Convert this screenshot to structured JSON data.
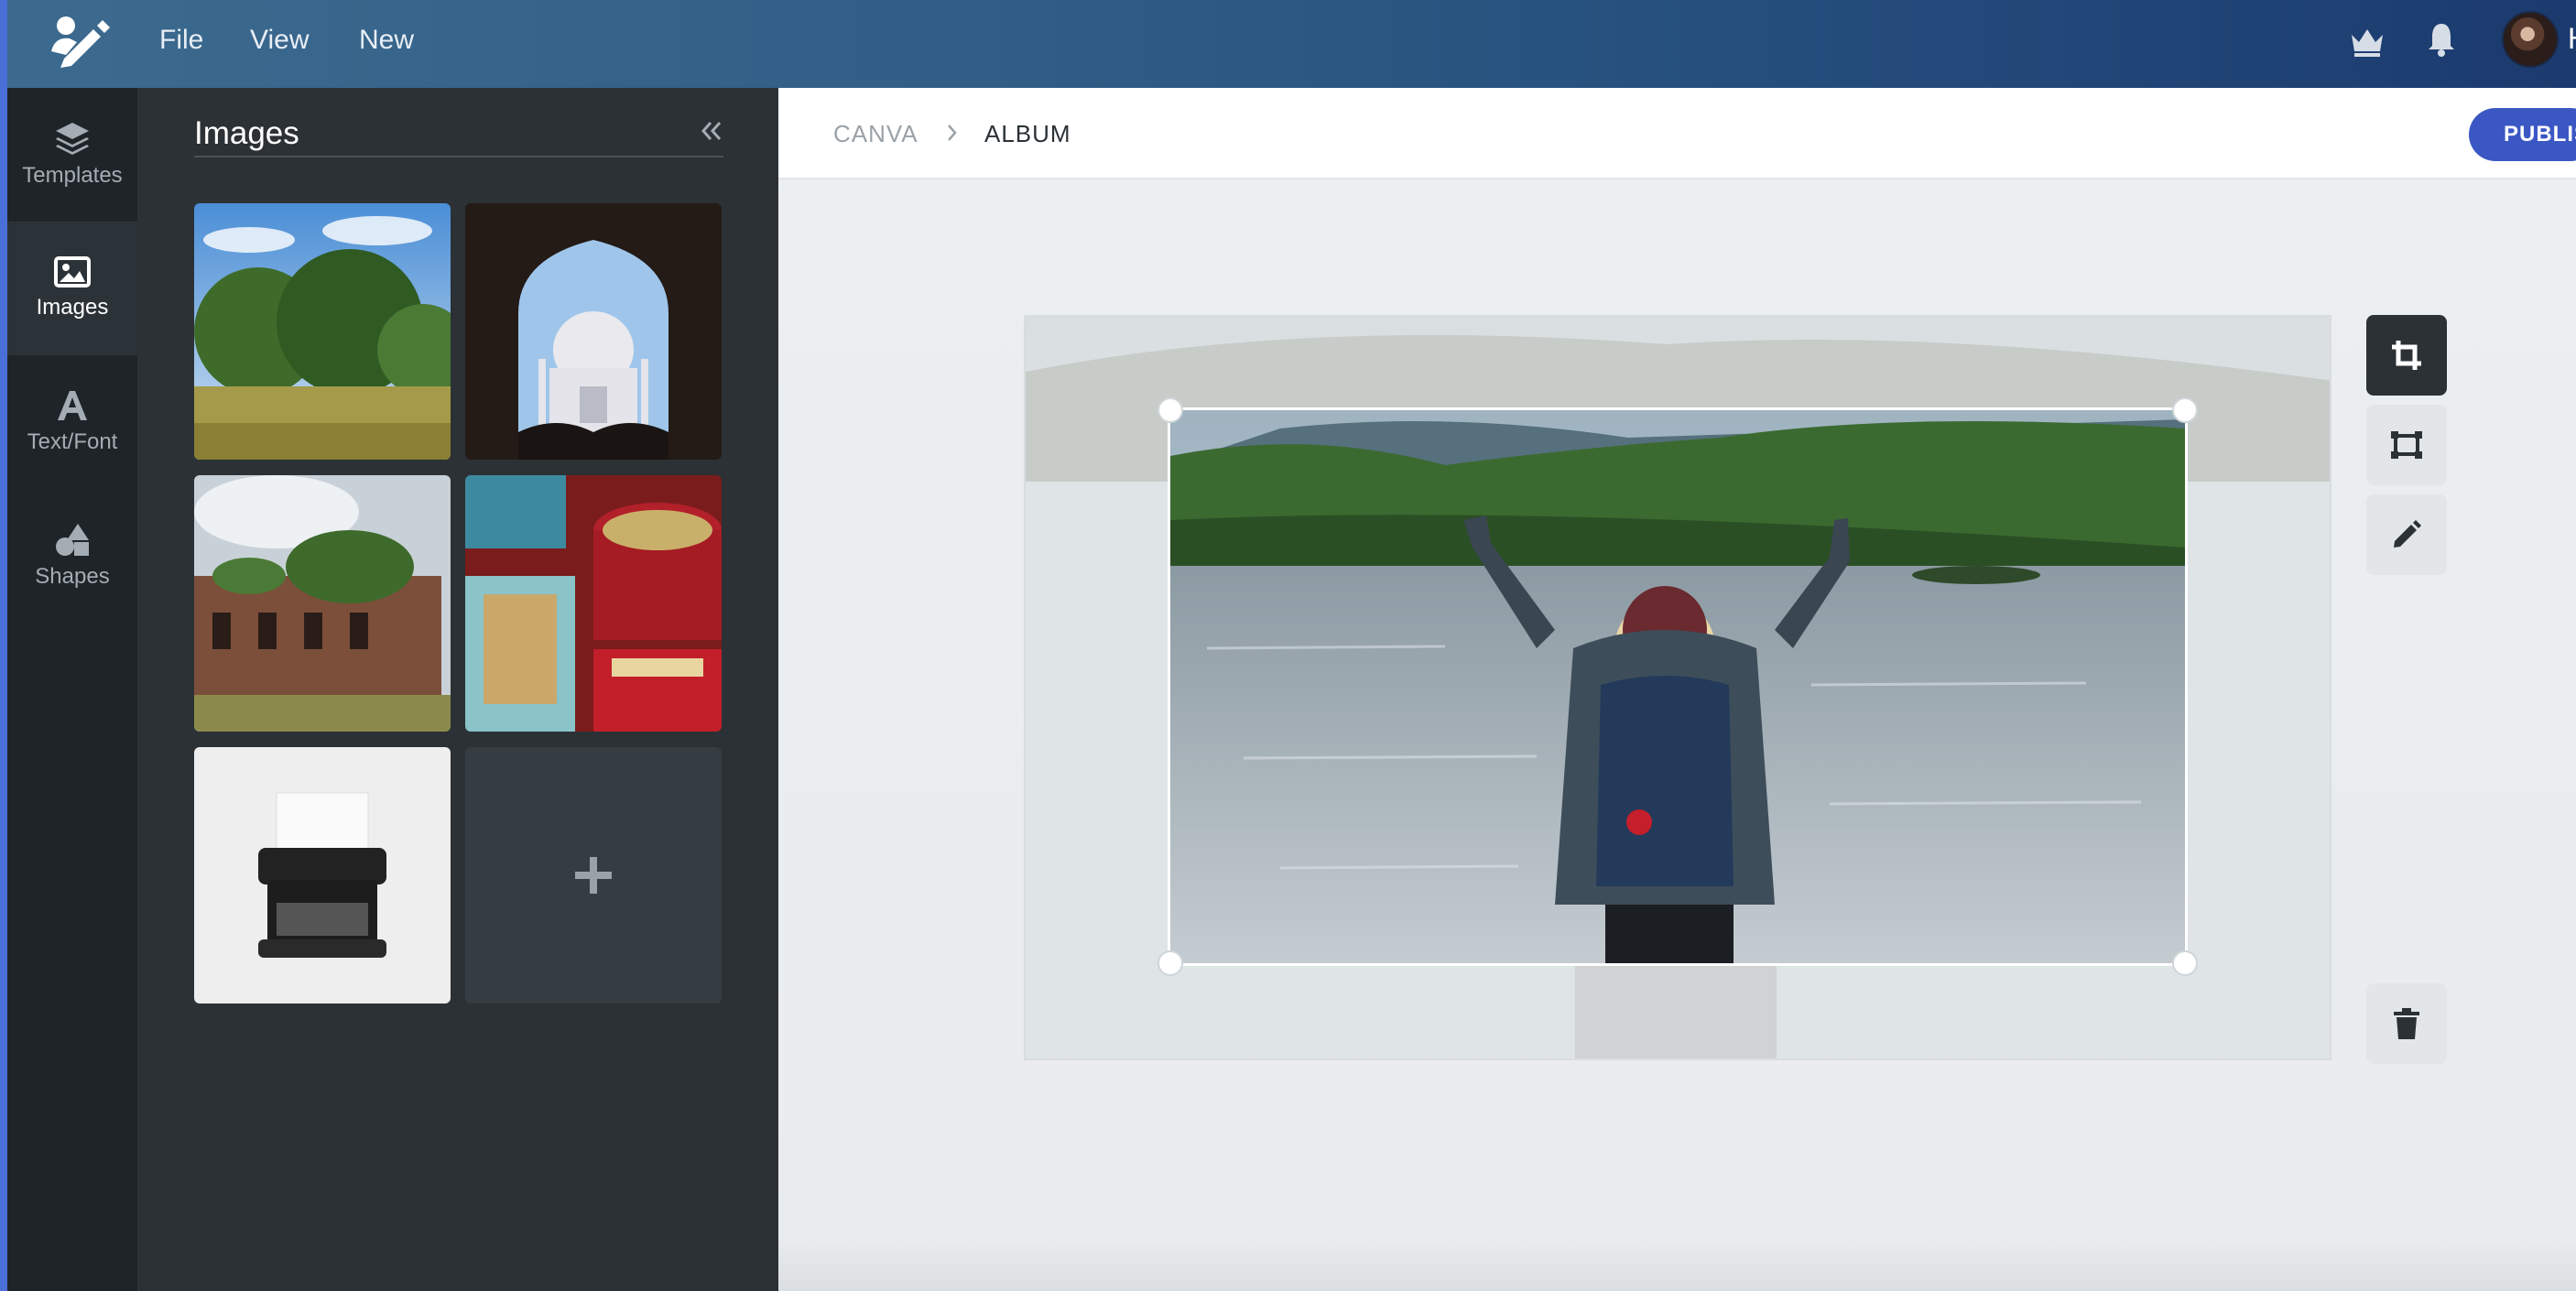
{
  "menu": {
    "file": "File",
    "view": "View",
    "new": "New"
  },
  "user": {
    "initial": "H"
  },
  "rail": {
    "templates": "Templates",
    "images": "Images",
    "text": "Text/Font",
    "shapes": "Shapes"
  },
  "panel": {
    "title": "Images"
  },
  "images": [
    "forest-sky",
    "taj-mahal-arch",
    "ruined-building",
    "vintage-tins",
    "typewriter"
  ],
  "breadcrumb": {
    "root": "CANVA",
    "current": "ALBUM"
  },
  "publish_label": "PUBLIS",
  "icons": {
    "logo": "pen-user-logo-icon",
    "crown": "crown-icon",
    "bell": "bell-icon",
    "templates": "layers-icon",
    "images": "image-icon",
    "text": "letter-a-icon",
    "shapes": "shapes-icon",
    "collapse": "double-chevron-left-icon",
    "add": "plus-icon",
    "crop": "crop-icon",
    "resize": "resize-frame-icon",
    "edit": "pencil-icon",
    "delete": "trash-icon"
  },
  "colors": {
    "accent": "#3b57c4",
    "rail_bg": "#1f2428",
    "panel_bg": "#2b3135",
    "workspace_bg": "#eceff1"
  }
}
